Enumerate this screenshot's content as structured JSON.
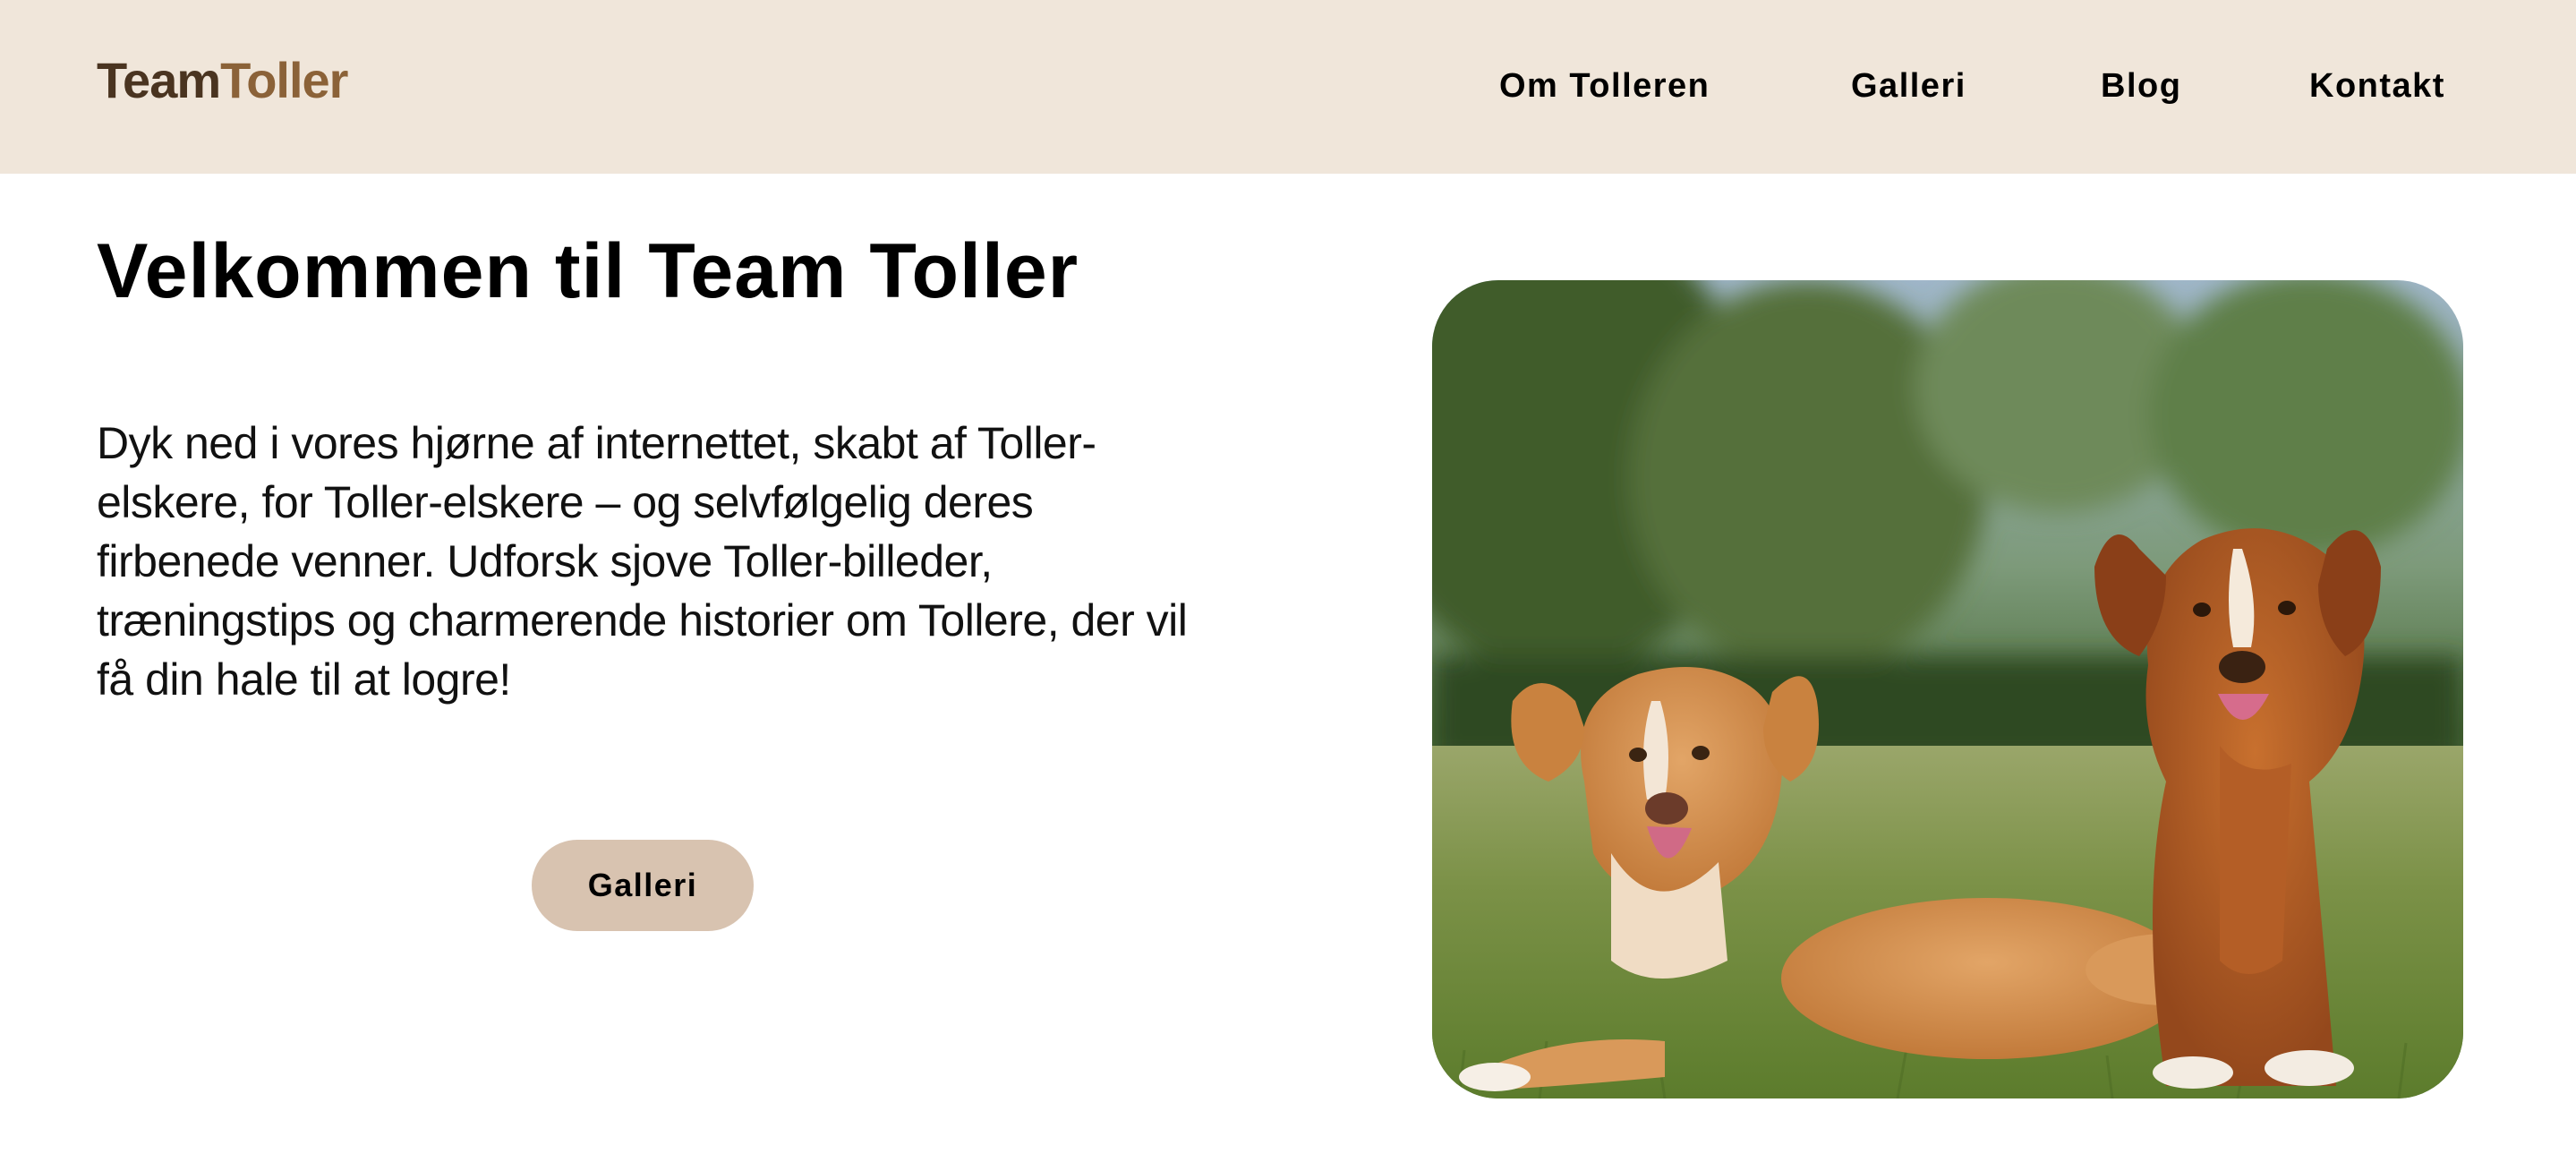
{
  "header": {
    "logo": {
      "part1": "Team",
      "part2": "Toller"
    },
    "nav": [
      {
        "label": "Om Tolleren"
      },
      {
        "label": "Galleri"
      },
      {
        "label": "Blog"
      },
      {
        "label": "Kontakt"
      }
    ]
  },
  "hero": {
    "title": "Velkommen til Team Toller",
    "text": "Dyk ned i vores hjørne af internettet, skabt af Toller-elskere, for Toller-elskere – og selvfølgelig deres firbenede venner. Udforsk sjove Toller-billeder, træningstips og charmerende historier om Tollere, der vil få din hale til at logre!",
    "button_label": "Galleri",
    "image": {
      "icon": "photo-two-toller-dogs-on-grass"
    }
  },
  "colors": {
    "header_bg": "#f0e6da",
    "logo_dark": "#4a3420",
    "logo_accent": "#8b6238",
    "button_bg": "#d8c3b0"
  }
}
